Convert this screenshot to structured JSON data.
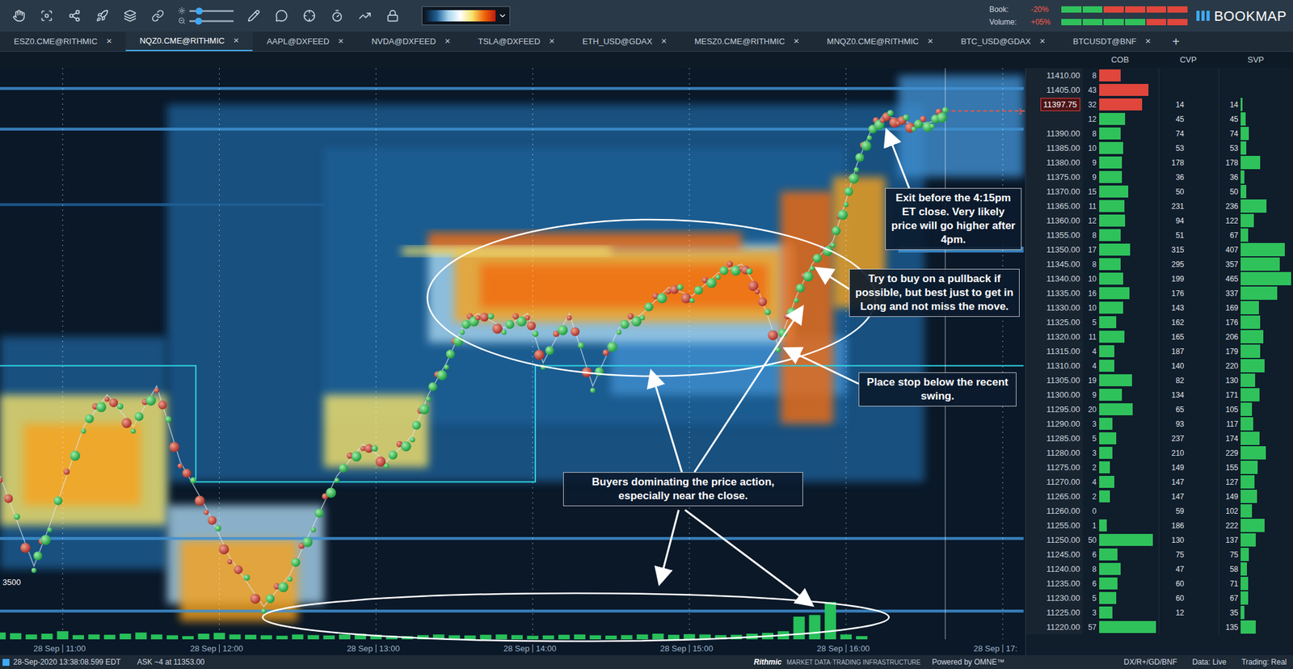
{
  "toolbar": {
    "sliders": [
      {
        "level": 0.22
      },
      {
        "level": 0.2
      }
    ],
    "book": {
      "label": "Book:",
      "value": "-20%",
      "level": 0.4
    },
    "volume": {
      "label": "Volume:",
      "value": "+05%",
      "level": 0.6
    },
    "logo": "BOOKMAP"
  },
  "tabs": [
    {
      "label": "ESZ0.CME@RITHMIC",
      "selected": false
    },
    {
      "label": "NQZ0.CME@RITHMIC",
      "selected": true
    },
    {
      "label": "AAPL@DXFEED",
      "selected": false
    },
    {
      "label": "NVDA@DXFEED",
      "selected": false
    },
    {
      "label": "TSLA@DXFEED",
      "selected": false
    },
    {
      "label": "ETH_USD@GDAX",
      "selected": false
    },
    {
      "label": "MESZ0.CME@RITHMIC",
      "selected": false
    },
    {
      "label": "MNQZ0.CME@RITHMIC",
      "selected": false
    },
    {
      "label": "BTC_USD@GDAX",
      "selected": false
    },
    {
      "label": "BTCUSDT@BNF",
      "selected": false
    }
  ],
  "tab_close": "×",
  "add_tab": "+",
  "columns": [
    "COB",
    "CVP",
    "SVP"
  ],
  "price_rows": [
    {
      "price": "11410.00",
      "cob": "8",
      "side": "ask",
      "cvp": "",
      "svp": "",
      "current": false
    },
    {
      "price": "11405.00",
      "cob": "43",
      "side": "ask",
      "cvp": "",
      "svp": "",
      "current": false
    },
    {
      "price": "11397.75",
      "cob": "32",
      "side": "ask",
      "cvp": "14",
      "svp": "14",
      "current": true
    },
    {
      "price": "",
      "cob": "12",
      "side": "bid",
      "cvp": "45",
      "svp": "45",
      "current": false
    },
    {
      "price": "11390.00",
      "cob": "8",
      "side": "bid",
      "cvp": "74",
      "svp": "74",
      "current": false
    },
    {
      "price": "11385.00",
      "cob": "10",
      "side": "bid",
      "cvp": "53",
      "svp": "53",
      "current": false
    },
    {
      "price": "11380.00",
      "cob": "9",
      "side": "bid",
      "cvp": "178",
      "svp": "178",
      "current": false
    },
    {
      "price": "11375.00",
      "cob": "9",
      "side": "bid",
      "cvp": "36",
      "svp": "36",
      "current": false
    },
    {
      "price": "11370.00",
      "cob": "15",
      "side": "bid",
      "cvp": "50",
      "svp": "50",
      "current": false
    },
    {
      "price": "11365.00",
      "cob": "11",
      "side": "bid",
      "cvp": "231",
      "svp": "236",
      "current": false
    },
    {
      "price": "11360.00",
      "cob": "12",
      "side": "bid",
      "cvp": "94",
      "svp": "122",
      "current": false
    },
    {
      "price": "11355.00",
      "cob": "8",
      "side": "bid",
      "cvp": "51",
      "svp": "67",
      "current": false
    },
    {
      "price": "11350.00",
      "cob": "17",
      "side": "bid",
      "cvp": "315",
      "svp": "407",
      "current": false
    },
    {
      "price": "11345.00",
      "cob": "8",
      "side": "bid",
      "cvp": "295",
      "svp": "357",
      "current": false
    },
    {
      "price": "11340.00",
      "cob": "10",
      "side": "bid",
      "cvp": "199",
      "svp": "465",
      "current": false
    },
    {
      "price": "11335.00",
      "cob": "16",
      "side": "bid",
      "cvp": "176",
      "svp": "337",
      "current": false
    },
    {
      "price": "11330.00",
      "cob": "10",
      "side": "bid",
      "cvp": "143",
      "svp": "169",
      "current": false
    },
    {
      "price": "11325.00",
      "cob": "5",
      "side": "bid",
      "cvp": "162",
      "svp": "176",
      "current": false
    },
    {
      "price": "11320.00",
      "cob": "11",
      "side": "bid",
      "cvp": "165",
      "svp": "206",
      "current": false
    },
    {
      "price": "11315.00",
      "cob": "4",
      "side": "bid",
      "cvp": "187",
      "svp": "179",
      "current": false
    },
    {
      "price": "11310.00",
      "cob": "4",
      "side": "bid",
      "cvp": "140",
      "svp": "220",
      "current": false
    },
    {
      "price": "11305.00",
      "cob": "19",
      "side": "bid",
      "cvp": "82",
      "svp": "130",
      "current": false
    },
    {
      "price": "11300.00",
      "cob": "9",
      "side": "bid",
      "cvp": "134",
      "svp": "171",
      "current": false
    },
    {
      "price": "11295.00",
      "cob": "20",
      "side": "bid",
      "cvp": "65",
      "svp": "105",
      "current": false
    },
    {
      "price": "11290.00",
      "cob": "3",
      "side": "bid",
      "cvp": "93",
      "svp": "117",
      "current": false
    },
    {
      "price": "11285.00",
      "cob": "5",
      "side": "bid",
      "cvp": "237",
      "svp": "174",
      "current": false
    },
    {
      "price": "11280.00",
      "cob": "3",
      "side": "bid",
      "cvp": "210",
      "svp": "229",
      "current": false
    },
    {
      "price": "11275.00",
      "cob": "2",
      "side": "bid",
      "cvp": "149",
      "svp": "155",
      "current": false
    },
    {
      "price": "11270.00",
      "cob": "4",
      "side": "bid",
      "cvp": "147",
      "svp": "127",
      "current": false
    },
    {
      "price": "11265.00",
      "cob": "2",
      "side": "bid",
      "cvp": "147",
      "svp": "149",
      "current": false
    },
    {
      "price": "11260.00",
      "cob": "0",
      "side": "bid",
      "cvp": "59",
      "svp": "102",
      "current": false
    },
    {
      "price": "11255.00",
      "cob": "1",
      "side": "bid",
      "cvp": "186",
      "svp": "222",
      "current": false
    },
    {
      "price": "11250.00",
      "cob": "50",
      "side": "bid",
      "cvp": "130",
      "svp": "137",
      "current": false
    },
    {
      "price": "11245.00",
      "cob": "6",
      "side": "bid",
      "cvp": "75",
      "svp": "75",
      "current": false
    },
    {
      "price": "11240.00",
      "cob": "8",
      "side": "bid",
      "cvp": "47",
      "svp": "58",
      "current": false
    },
    {
      "price": "11235.00",
      "cob": "6",
      "side": "bid",
      "cvp": "60",
      "svp": "71",
      "current": false
    },
    {
      "price": "11230.00",
      "cob": "5",
      "side": "bid",
      "cvp": "60",
      "svp": "67",
      "current": false
    },
    {
      "price": "11225.00",
      "cob": "3",
      "side": "bid",
      "cvp": "12",
      "svp": "35",
      "current": false
    },
    {
      "price": "11220.00",
      "cob": "57",
      "side": "bid",
      "cvp": "",
      "svp": "135",
      "current": false
    }
  ],
  "chart": {
    "price_points": [
      [
        636,
        11272
      ],
      [
        649,
        11241
      ],
      [
        655,
        11255
      ],
      [
        668,
        11289
      ],
      [
        677,
        11300
      ],
      [
        687,
        11289
      ],
      [
        696,
        11303
      ],
      [
        705,
        11277
      ],
      [
        715,
        11261
      ],
      [
        724,
        11244
      ],
      [
        737,
        11227
      ],
      [
        747,
        11238
      ],
      [
        756,
        11255
      ],
      [
        765,
        11272
      ],
      [
        775,
        11283
      ],
      [
        784,
        11277
      ],
      [
        794,
        11286
      ],
      [
        800,
        11300
      ],
      [
        807,
        11311
      ],
      [
        813,
        11323
      ],
      [
        819,
        11328
      ],
      [
        829,
        11323
      ],
      [
        838,
        11328
      ],
      [
        844,
        11311
      ],
      [
        854,
        11328
      ],
      [
        863,
        11303
      ],
      [
        873,
        11323
      ],
      [
        882,
        11328
      ],
      [
        892,
        11337
      ],
      [
        901,
        11334
      ],
      [
        911,
        11342
      ],
      [
        920,
        11345
      ],
      [
        926,
        11337
      ],
      [
        934,
        11317
      ],
      [
        941,
        11334
      ],
      [
        947,
        11345
      ],
      [
        955,
        11353
      ],
      [
        960,
        11367
      ],
      [
        964,
        11379
      ],
      [
        969,
        11390
      ],
      [
        974,
        11396
      ],
      [
        980,
        11395
      ],
      [
        986,
        11393
      ],
      [
        993,
        11394
      ],
      [
        998,
        11398
      ]
    ],
    "current_price": 11397.75,
    "current_marker": "1",
    "reference_line": [
      [
        636,
        11310
      ],
      [
        711,
        11310
      ],
      [
        711,
        11270
      ],
      [
        841,
        11270
      ],
      [
        841,
        11310
      ],
      [
        1028,
        11310
      ]
    ],
    "heatmap": [
      {
        "t0": 700,
        "t1": 990,
        "p0": 11270,
        "p1": 11400,
        "level": 0.3
      },
      {
        "t0": 760,
        "t1": 960,
        "p0": 11290,
        "p1": 11385,
        "level": 0.38
      },
      {
        "t0": 636,
        "t1": 700,
        "p0": 11240,
        "p1": 11320,
        "level": 0.35
      },
      {
        "t0": 636,
        "t1": 700,
        "p0": 11255,
        "p1": 11300,
        "level": 0.72
      },
      {
        "t0": 645,
        "t1": 690,
        "p0": 11262,
        "p1": 11290,
        "level": 0.86
      },
      {
        "t0": 700,
        "t1": 760,
        "p0": 11228,
        "p1": 11262,
        "level": 0.6
      },
      {
        "t0": 705,
        "t1": 750,
        "p0": 11222,
        "p1": 11250,
        "level": 0.88
      },
      {
        "t0": 760,
        "t1": 800,
        "p0": 11275,
        "p1": 11300,
        "level": 0.78
      },
      {
        "t0": 870,
        "t1": 960,
        "p0": 11300,
        "p1": 11320,
        "level": 0.5
      },
      {
        "t0": 800,
        "t1": 940,
        "p0": 11318,
        "p1": 11352,
        "level": 0.65
      },
      {
        "t0": 810,
        "t1": 935,
        "p0": 11325,
        "p1": 11350,
        "level": 0.85
      },
      {
        "t0": 820,
        "t1": 930,
        "p0": 11330,
        "p1": 11345,
        "level": 0.92
      },
      {
        "t0": 935,
        "t1": 955,
        "p0": 11290,
        "p1": 11370,
        "level": 0.9
      },
      {
        "t0": 955,
        "t1": 975,
        "p0": 11330,
        "p1": 11375,
        "level": 0.82
      },
      {
        "t0": 980,
        "t1": 1028,
        "p0": 11375,
        "p1": 11410,
        "level": 0.45
      },
      {
        "t0": 800,
        "t1": 920,
        "p0": 11350,
        "p1": 11356,
        "level": 0.95
      },
      {
        "t0": 790,
        "t1": 870,
        "p0": 11348,
        "p1": 11351,
        "level": 0.7
      },
      {
        "t0": 636,
        "t1": 1028,
        "p0": 11405,
        "p1": 11406,
        "level": 0.45
      },
      {
        "t0": 636,
        "t1": 1028,
        "p0": 11391,
        "p1": 11392,
        "level": 0.42
      },
      {
        "t0": 636,
        "t1": 1028,
        "p0": 11250,
        "p1": 11251,
        "level": 0.45
      },
      {
        "t0": 636,
        "t1": 1028,
        "p0": 11225,
        "p1": 11226,
        "level": 0.42
      },
      {
        "t0": 980,
        "t1": 1028,
        "p0": 11349,
        "p1": 11351,
        "level": 0.5
      },
      {
        "t0": 636,
        "t1": 760,
        "p0": 11365,
        "p1": 11366,
        "level": 0.35
      }
    ],
    "volume": {
      "start": 636,
      "step": 6,
      "values": [
        420,
        380,
        300,
        350,
        500,
        260,
        300,
        280,
        350,
        420,
        300,
        250,
        200,
        350,
        400,
        300,
        280,
        250,
        220,
        300,
        260,
        240,
        300,
        350,
        280,
        220,
        200,
        260,
        300,
        250,
        240,
        280,
        300,
        260,
        220,
        240,
        280,
        300,
        250,
        230,
        260,
        300,
        350,
        280,
        320,
        300,
        260,
        280,
        350,
        400,
        500,
        1400,
        1500,
        2300,
        300,
        200
      ]
    },
    "volume_scale": "3500",
    "time_labels": [
      {
        "date": "28 Sep",
        "time": "11:00",
        "minute": 660
      },
      {
        "date": "28 Sep",
        "time": "12:00",
        "minute": 720
      },
      {
        "date": "28 Sep",
        "time": "13:00",
        "minute": 780
      },
      {
        "date": "28 Sep",
        "time": "14:00",
        "minute": 840
      },
      {
        "date": "28 Sep",
        "time": "15:00",
        "minute": 900
      },
      {
        "date": "28 Sep",
        "time": "16:00",
        "minute": 960
      },
      {
        "date": "28 Sep",
        "time": "17:",
        "minute": 1020
      }
    ],
    "annotations": [
      {
        "text": "Exit before the 4:15pm ET close. Very likely price will go higher after 4pm."
      },
      {
        "text": "Try to buy on a pullback if possible, but best just to get in Long and not miss the move."
      },
      {
        "text": "Place stop below the recent swing."
      },
      {
        "text": "Buyers dominating the price action, especially near the close."
      }
    ]
  },
  "status_bar": {
    "time": "28-Sep-2020 13:38:08.599 EDT",
    "quote": "ASK ~4 at 11353.00",
    "provider": "Rithmic",
    "provider_tagline": "MARKET DATA·TRADING INFRASTRUCTURE",
    "powered": "Powered by OMNE™",
    "feeds": "DX/R+/GD/BNF",
    "data": "Data: Live",
    "trading": "Trading: Real"
  }
}
